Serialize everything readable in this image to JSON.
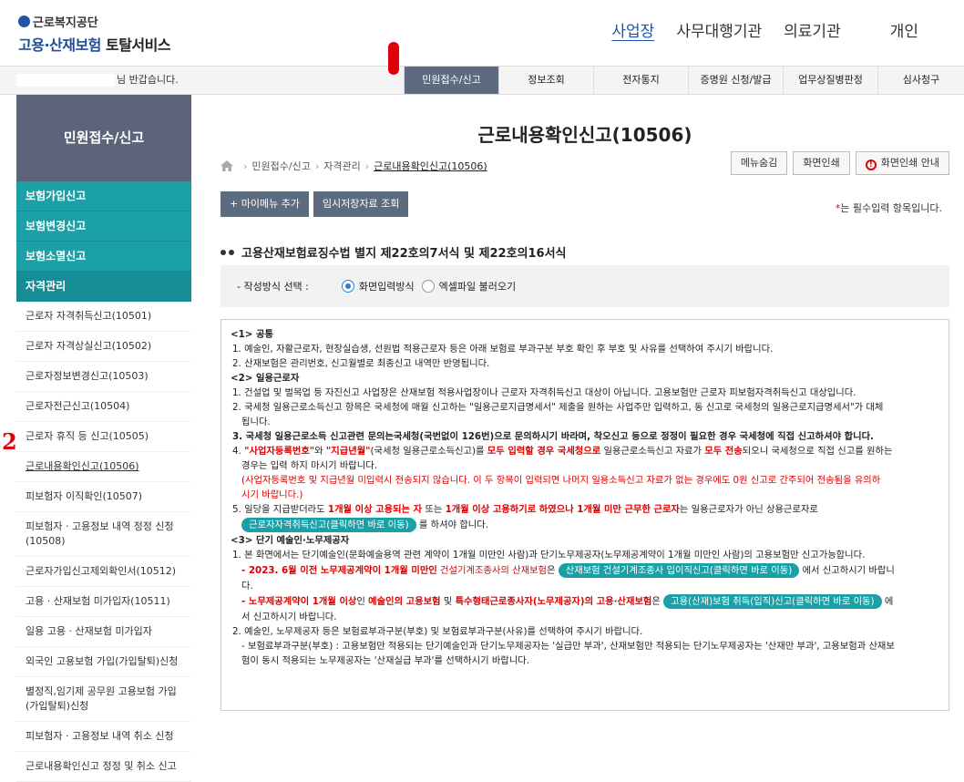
{
  "header": {
    "logo_org": "근로복지공단",
    "logo_service_a": "고용·산재보험 ",
    "logo_service_b": "토탈서비스",
    "user_tabs": [
      "사업장",
      "사무대행기관",
      "의료기관",
      "개인"
    ]
  },
  "topbar": {
    "welcome": "님 반갑습니다.",
    "gnb": [
      "민원접수/신고",
      "정보조회",
      "전자통지",
      "증명원 신청/발급",
      "업무상질병판정",
      "심사청구"
    ]
  },
  "sidebar": {
    "title": "민원접수/신고",
    "main_items": [
      "보험가입신고",
      "보험변경신고",
      "보험소멸신고",
      "자격관리"
    ],
    "sub_items": [
      "근로자 자격취득신고(10501)",
      "근로자 자격상실신고(10502)",
      "근로자정보변경신고(10503)",
      "근로자전근신고(10504)",
      "근로자 휴직 등 신고(10505)",
      "근로내용확인신고(10506)",
      "피보험자 이직확인(10507)",
      "피보험자 · 고용정보 내역 정정 신청(10508)",
      "근로자가입신고제외확인서(10512)",
      "고용 · 산재보험 미가입자(10511)",
      "일용 고용 · 산재보험 미가입자",
      "외국인 고용보험 가입(가입탈퇴)신청",
      "별정직,임기제 공무원 고용보험 가입(가입탈퇴)신청",
      "피보험자 · 고용정보 내역 취소 신청",
      "근로내용확인신고 정정 및 취소 신고"
    ],
    "annotation": "2"
  },
  "main": {
    "title": "근로내용확인신고(10506)",
    "breadcrumb": [
      "민원접수/신고",
      "자격관리",
      "근로내용확인신고(10506)"
    ],
    "tools": [
      "메뉴숨김",
      "화면인쇄",
      "화면인쇄 안내"
    ],
    "actions": [
      "+ 마이메뉴 추가",
      "임시저장자료 조회"
    ],
    "required_note_star": "*",
    "required_note": "는 필수입력 항목입니다.",
    "form_title": "고용산재보험료징수법 별지 제22호의7서식 및 제22호의16서식",
    "method_label": "- 작성방식 선택 :",
    "method_options": [
      "화면입력방식",
      "엑셀파일 불러오기"
    ],
    "method_selected": "화면입력방식"
  },
  "notice": {
    "s1_title": "<1> 공통",
    "s1_1": "1. 예술인, 자활근로자, 현장실습생, 선원법 적용근로자 등은 아래 보험료 부과구분 부호 확인 후 부호 및 사유를 선택하여 주시기 바랍니다.",
    "s1_2": "2. 산재보험은 관리번호, 신고월별로 최종신고 내역만 반영됩니다.",
    "s2_title": "<2> 일용근로자",
    "s2_1": "1. 건설업 및 벌목업 등 자진신고 사업장은 산재보험 적용사업장이나 근로자 자격취득신고 대상이 아닙니다. 고용보험만 근로자 피보험자격취득신고 대상입니다.",
    "s2_2a": "2. 국세청 일용근로소득신고 항목은 국세청에 매월 신고하는 \"일용근로지급명세서\" 제출을 원하는 사업주만 입력하고, 동 신고로 국세청의 일용근로지급명세서\"가 대체",
    "s2_2b": "됩니다.",
    "s2_3": "3. 국세청 일용근로소득 신고관련 문의는국세청(국번없이 126번)으로 문의하시기 바라며, 착오신고 등으로 정정이 필요한 경우 국세청에 직접 신고하셔야 합니다.",
    "s2_4_a": "4. ",
    "s2_4_b": "\"사업자등록번호\"",
    "s2_4_c": "와 ",
    "s2_4_d": "\"지급년월\"",
    "s2_4_e": "(국세청 일용근로소득신고)를 ",
    "s2_4_f": "모두 입력할 경우 국세청으로",
    "s2_4_g": " 일용근로소득신고 자료가 ",
    "s2_4_h": "모두 전송",
    "s2_4_i": "되오니 국세청으로 직접 신고를 원하는",
    "s2_4_j": "경우는 입력 하지 마시기 바랍니다.",
    "s2_4_k": "(사업자등록번호 및 지급년월 미입력시 전송되지 않습니다. 이 두 항목이 입력되면 나머지 일용소득신고 자료가 없는 경우에도 0원 신고로 간주되어 전송됨을 유의하",
    "s2_4_l": "시기 바랍니다.)",
    "s2_5_a": "5. 일당을 지급받더라도 ",
    "s2_5_b": "1개월 이상 고용되는 자",
    "s2_5_c": " 또는 ",
    "s2_5_d": "1개월 이상 고용하기로 하였으나 1개월 미만 근무한 근로자",
    "s2_5_e": "는 일용근로자가 아닌 상용근로자로",
    "s2_5_pill": "근로자자격취득신고(클릭하면 바로 이동)",
    "s2_5_f": " 를 하셔야 합니다.",
    "s3_title": "<3> 단기 예술인·노무제공자",
    "s3_1": "1. 본 화면에서는 단기예술인(문화예술용역 관련 계약이 1개월 미만인 사람)과 단기노무제공자(노무제공계약이 1개월 미만인 사람)의 고용보험만 신고가능합니다.",
    "s3_1a_a": "- 2023. 6월 이전 노무제공계약이 1개월 미만인",
    "s3_1a_b": " 건설기계조종사의 산재보험",
    "s3_1a_c": "은 ",
    "s3_1a_pill": "산재보험 건설기계조종사 입이직신고(클릭하면 바로 이동)",
    "s3_1a_d": " 에서 신고하시기 바랍니",
    "s3_1a_e": "다.",
    "s3_1b_a": "- 노무제공계약이 1개월 이상",
    "s3_1b_b": "인 ",
    "s3_1b_c": "예술인의 고용보험",
    "s3_1b_d": " 및 ",
    "s3_1b_e": "특수형태근로종사자(노무제공자)의 고용·산재보험",
    "s3_1b_f": "은 ",
    "s3_1b_pill": "고용(산재)보험 취득(입직)신고(클릭하면 바로 이동)",
    "s3_1b_g": " 에",
    "s3_1b_h": "서 신고하시기 바랍니다.",
    "s3_2": "2. 예술인, 노무제공자 등은 보험료부과구분(부호) 및 보험료부과구분(사유)를 선택하여 주시기 바랍니다.",
    "s3_2a": "- 보험료부과구분(부호) : 고용보험만 적용되는 단기예술인과 단기노무제공자는 '실급만 부과', 산재보험만 적용되는 단기노무제공자는 '산재만 부과', 고용보험과 산재보",
    "s3_2b": "험이 동시 적용되는 노무제공자는 '산재실급 부과'를 선택하시기 바랍니다."
  }
}
